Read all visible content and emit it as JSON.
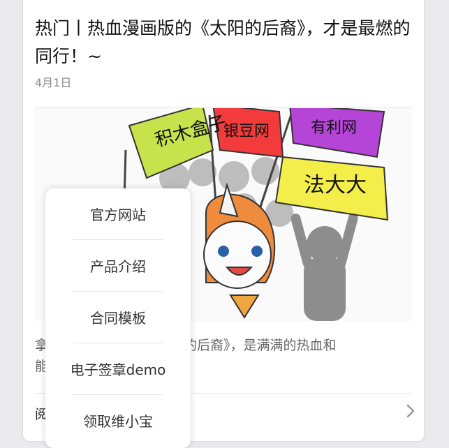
{
  "article": {
    "title": "热门丨热血漫画版的《太阳的后裔》，才是最燃的同行！~",
    "date": "4月1日",
    "summary_left": "拿",
    "summary_left2": "能",
    "summary_right": "阳的后裔》，是满满的热血和",
    "read_more_partial": "阅",
    "read_more_chevron": "chevron-right-icon"
  },
  "cover": {
    "flags": [
      {
        "text": "积木盒子",
        "color": "#c7e24b"
      },
      {
        "text": "银豆网",
        "color": "#f43b3b"
      },
      {
        "text": "有利网",
        "color": "#b445d6"
      },
      {
        "text": "法大大",
        "color": "#f3ee4a"
      }
    ]
  },
  "menu": {
    "items": [
      {
        "label": "官方网站"
      },
      {
        "label": "产品介绍"
      },
      {
        "label": "合同模板"
      },
      {
        "label": "电子签章demo"
      },
      {
        "label": "领取维小宝"
      }
    ]
  }
}
